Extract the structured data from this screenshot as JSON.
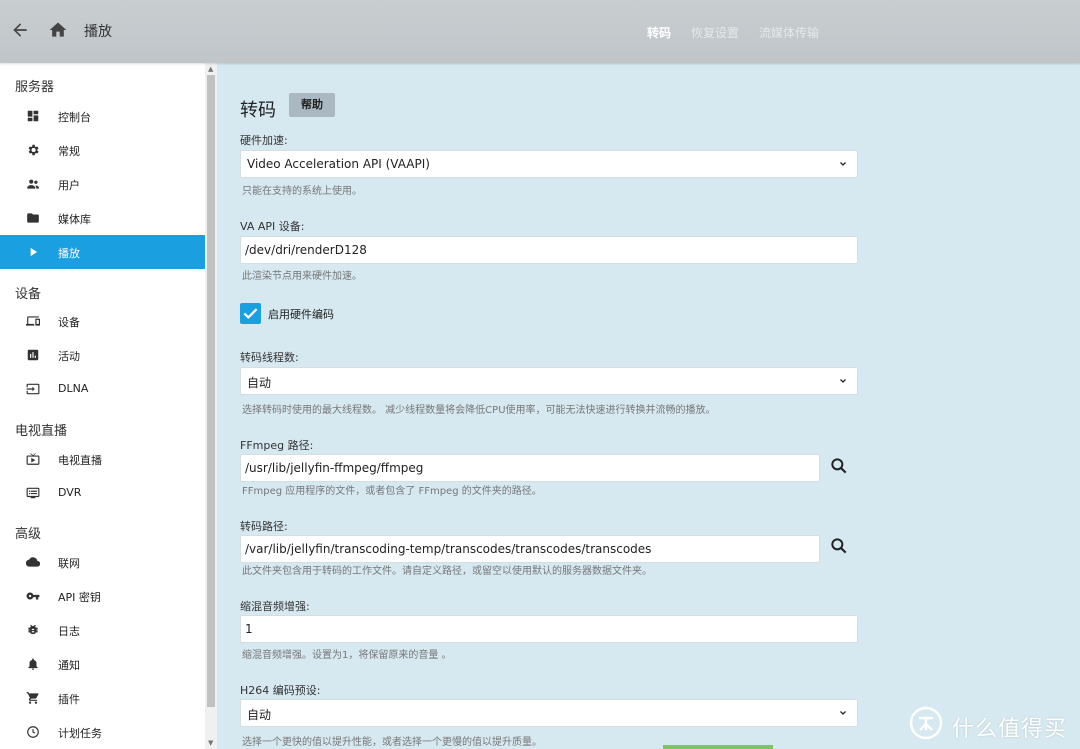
{
  "header": {
    "title": "播放",
    "tabs": [
      {
        "label": "转码",
        "active": true
      },
      {
        "label": "恢复设置",
        "active": false
      },
      {
        "label": "流媒体传输",
        "active": false
      }
    ]
  },
  "sidebar": {
    "sections": [
      {
        "title": "服务器",
        "items": [
          {
            "label": "控制台",
            "icon": "dashboard-icon"
          },
          {
            "label": "常规",
            "icon": "gear-icon"
          },
          {
            "label": "用户",
            "icon": "people-icon"
          },
          {
            "label": "媒体库",
            "icon": "folder-icon"
          },
          {
            "label": "播放",
            "icon": "play-icon",
            "active": true
          }
        ]
      },
      {
        "title": "设备",
        "items": [
          {
            "label": "设备",
            "icon": "devices-icon"
          },
          {
            "label": "活动",
            "icon": "activity-icon"
          },
          {
            "label": "DLNA",
            "icon": "input-icon"
          }
        ]
      },
      {
        "title": "电视直播",
        "items": [
          {
            "label": "电视直播",
            "icon": "live-tv-icon"
          },
          {
            "label": "DVR",
            "icon": "dvr-icon"
          }
        ]
      },
      {
        "title": "高级",
        "items": [
          {
            "label": "联网",
            "icon": "cloud-icon"
          },
          {
            "label": "API 密钥",
            "icon": "key-icon"
          },
          {
            "label": "日志",
            "icon": "bug-icon"
          },
          {
            "label": "通知",
            "icon": "bell-icon"
          },
          {
            "label": "插件",
            "icon": "cart-icon"
          },
          {
            "label": "计划任务",
            "icon": "clock-icon"
          }
        ]
      }
    ]
  },
  "main": {
    "heading": "转码",
    "help_label": "帮助",
    "hw_accel": {
      "label": "硬件加速:",
      "value": "Video Acceleration API (VAAPI)",
      "hint": "只能在支持的系统上使用。"
    },
    "vaapi_device": {
      "label": "VA API 设备:",
      "value": "/dev/dri/renderD128",
      "hint": "此渲染节点用来硬件加速。"
    },
    "hw_encoding": {
      "label": "启用硬件编码",
      "checked": true
    },
    "threads": {
      "label": "转码线程数:",
      "value": "自动",
      "hint": "选择转码时使用的最大线程数。 减少线程数量将会降低CPU使用率，可能无法快速进行转换并流畅的播放。"
    },
    "ffmpeg_path": {
      "label": "FFmpeg 路径:",
      "value": "/usr/lib/jellyfin-ffmpeg/ffmpeg",
      "hint": "FFmpeg 应用程序的文件，或者包含了 FFmpeg 的文件夹的路径。"
    },
    "transcode_path": {
      "label": "转码路径:",
      "value": "/var/lib/jellyfin/transcoding-temp/transcodes/transcodes/transcodes",
      "hint": "此文件夹包含用于转码的工作文件。请自定义路径，或留空以使用默认的服务器数据文件夹。"
    },
    "downmix": {
      "label": "缩混音频增强:",
      "value": "1",
      "hint": "缩混音频增强。设置为1，将保留原来的音量 。"
    },
    "h264_preset": {
      "label": "H264 编码预设:",
      "value": "自动",
      "hint": "选择一个更快的值以提升性能，或者选择一个更慢的值以提升质量。"
    }
  },
  "watermark": {
    "text": "什么值得买"
  },
  "colors": {
    "accent": "#1aa0e0",
    "background": "#d6e8f0",
    "header": "#c4cacd"
  }
}
